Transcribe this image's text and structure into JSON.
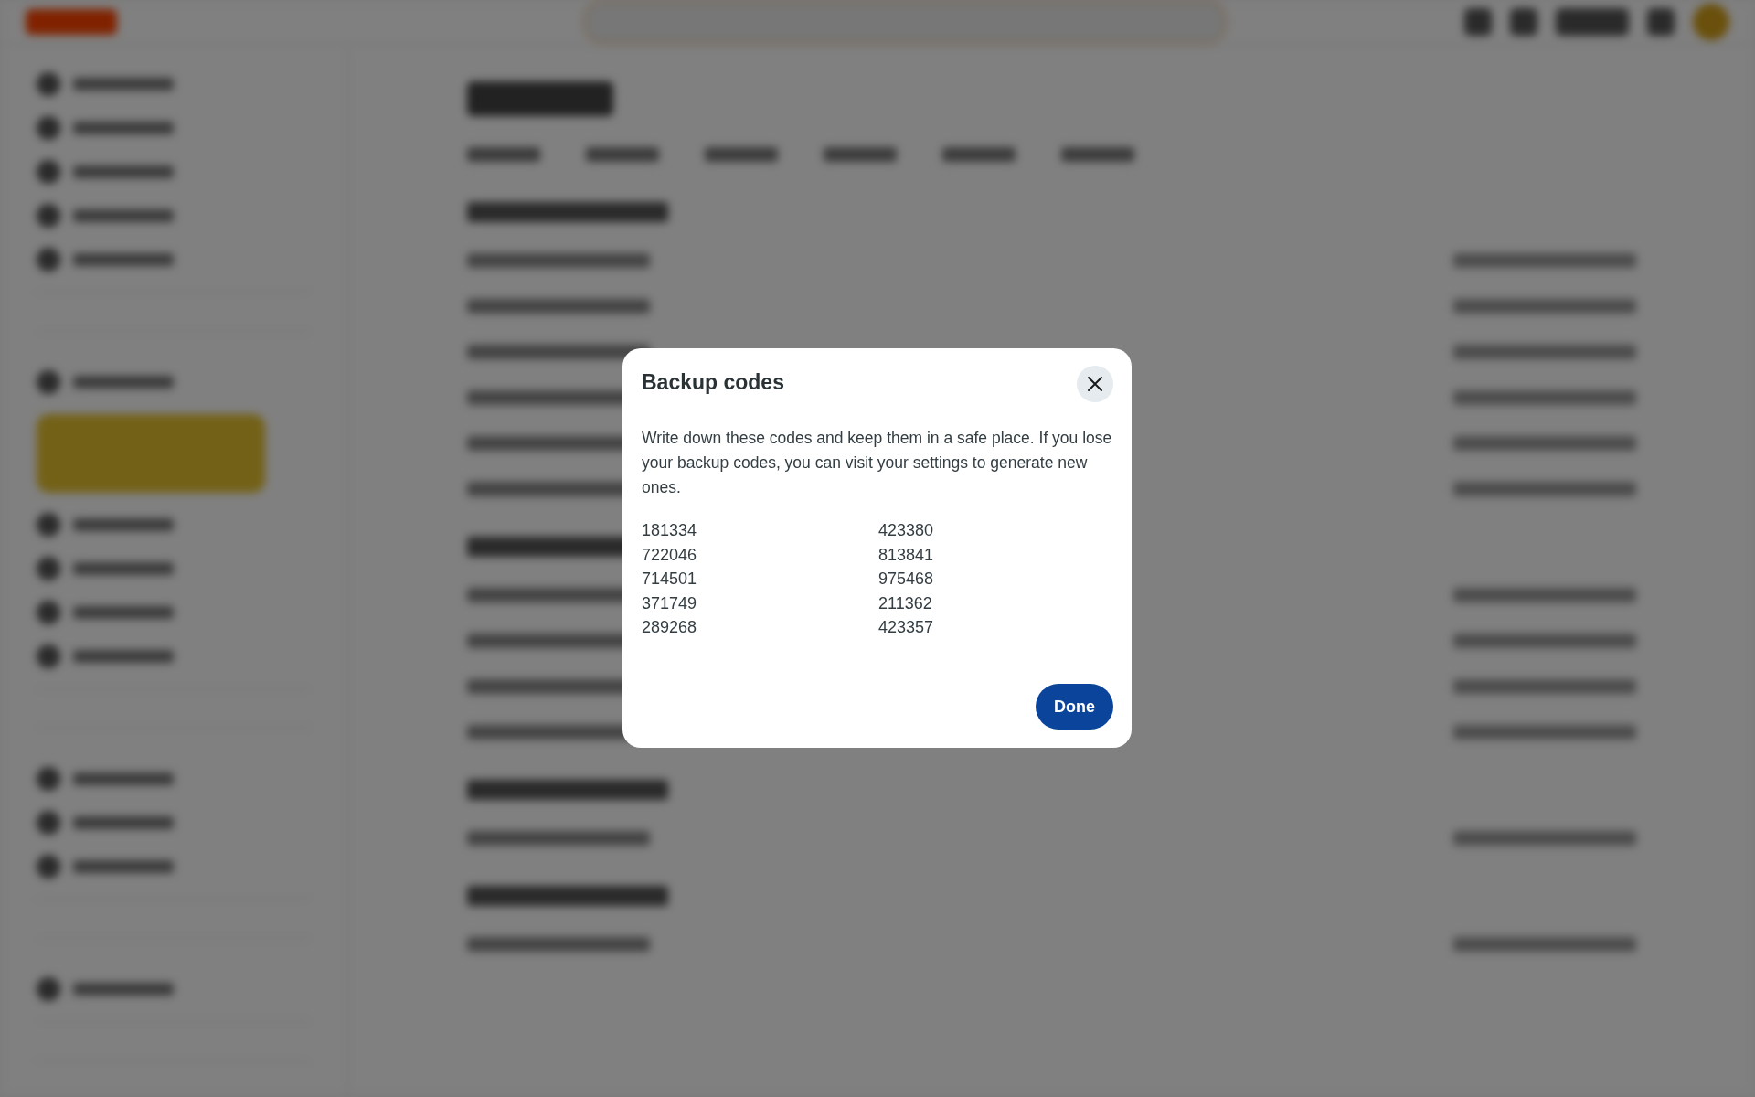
{
  "dialog": {
    "title": "Backup codes",
    "message": "Write down these codes and keep them in a safe place. If you lose your backup codes, you can visit your settings to generate new ones.",
    "codes": [
      "181334",
      "423380",
      "722046",
      "813841",
      "714501",
      "975468",
      "371749",
      "211362",
      "289268",
      "423357"
    ],
    "buttons": [
      "Done"
    ]
  }
}
